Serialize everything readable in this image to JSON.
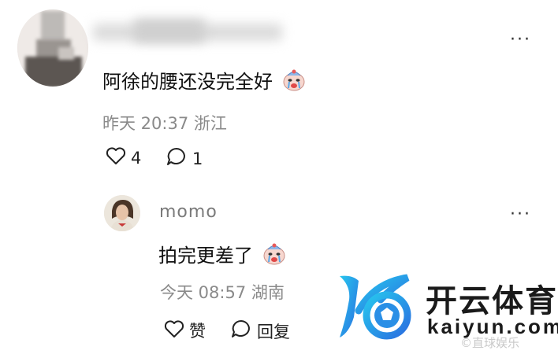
{
  "comment": {
    "text": "阿徐的腰还没完全好",
    "emoji_icon": "crying-clown-face-icon",
    "time": "昨天 20:37 浙江",
    "likes": "4",
    "replies": "1"
  },
  "reply": {
    "username": "momo",
    "text": "拍完更差了",
    "emoji_icon": "crying-clown-face-icon",
    "time": "今天 08:57 湖南",
    "like_label": "赞",
    "reply_label": "回复"
  },
  "watermark": {
    "brand_cn": "开云体育",
    "brand_en": "kaiyun.com",
    "source_text": "©直球娱乐"
  },
  "colors": {
    "accent_blue": "#2a7fe0",
    "brand_cyan": "#1db6e8",
    "meta_gray": "#8a8a8a"
  }
}
